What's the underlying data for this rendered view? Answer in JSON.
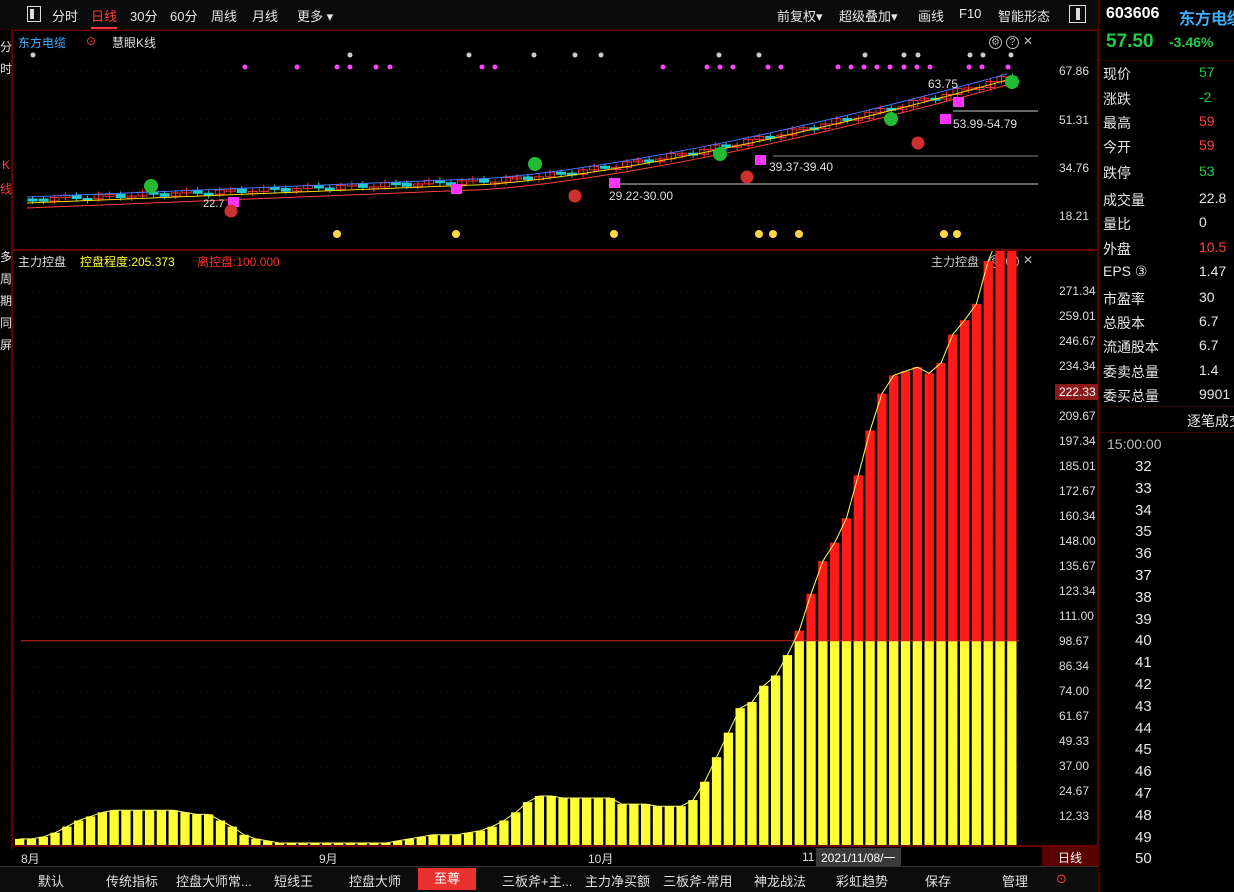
{
  "toolbar": {
    "items": [
      "分时",
      "日线",
      "30分",
      "60分",
      "周线",
      "月线",
      "更多 ▾"
    ],
    "active": "日线",
    "right_items": [
      "前复权▾",
      "超级叠加▾",
      "画线",
      "F10",
      "智能形态"
    ]
  },
  "left_strip": [
    "分",
    "时",
    "K",
    "线",
    "多",
    "周",
    "期",
    "同",
    "屏"
  ],
  "kpanel": {
    "stock_name": "东方电缆",
    "indicator": "慧眼K线",
    "axis": [
      "67.86",
      "51.31",
      "34.76",
      "18.21"
    ],
    "annotations": [
      "63.75",
      "53.99-54.79",
      "39.37-39.40",
      "29.22-30.00",
      "22.7"
    ]
  },
  "mpanel": {
    "title": "主力控盘",
    "value_label": "控盘程度:205.373",
    "exit_label": "离控盘:100.000",
    "right_title": "主力控盘",
    "axis": [
      "271.34",
      "259.01",
      "246.67",
      "234.34",
      "222.33",
      "209.67",
      "197.34",
      "185.01",
      "172.67",
      "160.34",
      "148.00",
      "135.67",
      "123.34",
      "111.00",
      "98.67",
      "86.34",
      "74.00",
      "61.67",
      "49.33",
      "37.00",
      "24.67",
      "12.33"
    ],
    "highlight": "222.33",
    "colors": {
      "yellow": "#ffff33",
      "red": "#ff1a1a",
      "line": "#cc2222"
    }
  },
  "datebar": {
    "months": [
      "8月",
      "9月",
      "10月",
      "11"
    ],
    "cursor_date": "2021/11/08/一",
    "period": "日线"
  },
  "tabs": [
    "默认",
    "传统指标",
    "控盘大师常...",
    "短线王",
    "控盘大师",
    "至尊",
    "三板斧+主...",
    "主力净买额",
    "三板斧-常用",
    "神龙战法",
    "彩虹趋势",
    "保存",
    "管理"
  ],
  "active_tab": "至尊",
  "quote": {
    "code": "603606",
    "name": "东方电缆",
    "price": "57.50",
    "change_pct": "-3.46%",
    "rows": [
      {
        "label": "现价",
        "value": "57"
      },
      {
        "label": "涨跌",
        "value": "-2"
      },
      {
        "label": "最高",
        "value": "59"
      },
      {
        "label": "今开",
        "value": "59"
      },
      {
        "label": "跌停",
        "value": "53"
      },
      {
        "label": "成交量",
        "value": "22.8"
      },
      {
        "label": "量比",
        "value": "0"
      },
      {
        "label": "外盘",
        "value": "10.5"
      },
      {
        "label": "EPS ③",
        "value": "1.47"
      },
      {
        "label": "市盈率",
        "value": "30"
      },
      {
        "label": "总股本",
        "value": "6.7"
      },
      {
        "label": "流通股本",
        "value": "6.7"
      },
      {
        "label": "委卖总量",
        "value": "1.4"
      },
      {
        "label": "委买总量",
        "value": "9901"
      }
    ],
    "trade_title": "逐笔成交",
    "time": "15:00:00",
    "numbers": [
      "32",
      "33",
      "34",
      "35",
      "36",
      "37",
      "38",
      "39",
      "40",
      "41",
      "42",
      "43",
      "44",
      "45",
      "46",
      "47",
      "48",
      "49",
      "50"
    ]
  },
  "chart_data": {
    "type": "bar",
    "title": "主力控盘",
    "threshold": 100,
    "ylim": [
      0,
      285
    ],
    "values": [
      3,
      3,
      4,
      6,
      9,
      12,
      14,
      16,
      17,
      17,
      17,
      17,
      17,
      17,
      16,
      15,
      15,
      12,
      9,
      5,
      3,
      2,
      1,
      1,
      1,
      1,
      1,
      1,
      1,
      1,
      1,
      1,
      2,
      3,
      4,
      5,
      5,
      5,
      6,
      7,
      9,
      12,
      16,
      21,
      24,
      24,
      23,
      23,
      23,
      23,
      23,
      20,
      20,
      20,
      19,
      19,
      19,
      22,
      31,
      43,
      55,
      67,
      70,
      78,
      83,
      93,
      105,
      123,
      139,
      148,
      160,
      181,
      203,
      221,
      230,
      232,
      234,
      231,
      236,
      250,
      257,
      265,
      286,
      300,
      320
    ]
  }
}
